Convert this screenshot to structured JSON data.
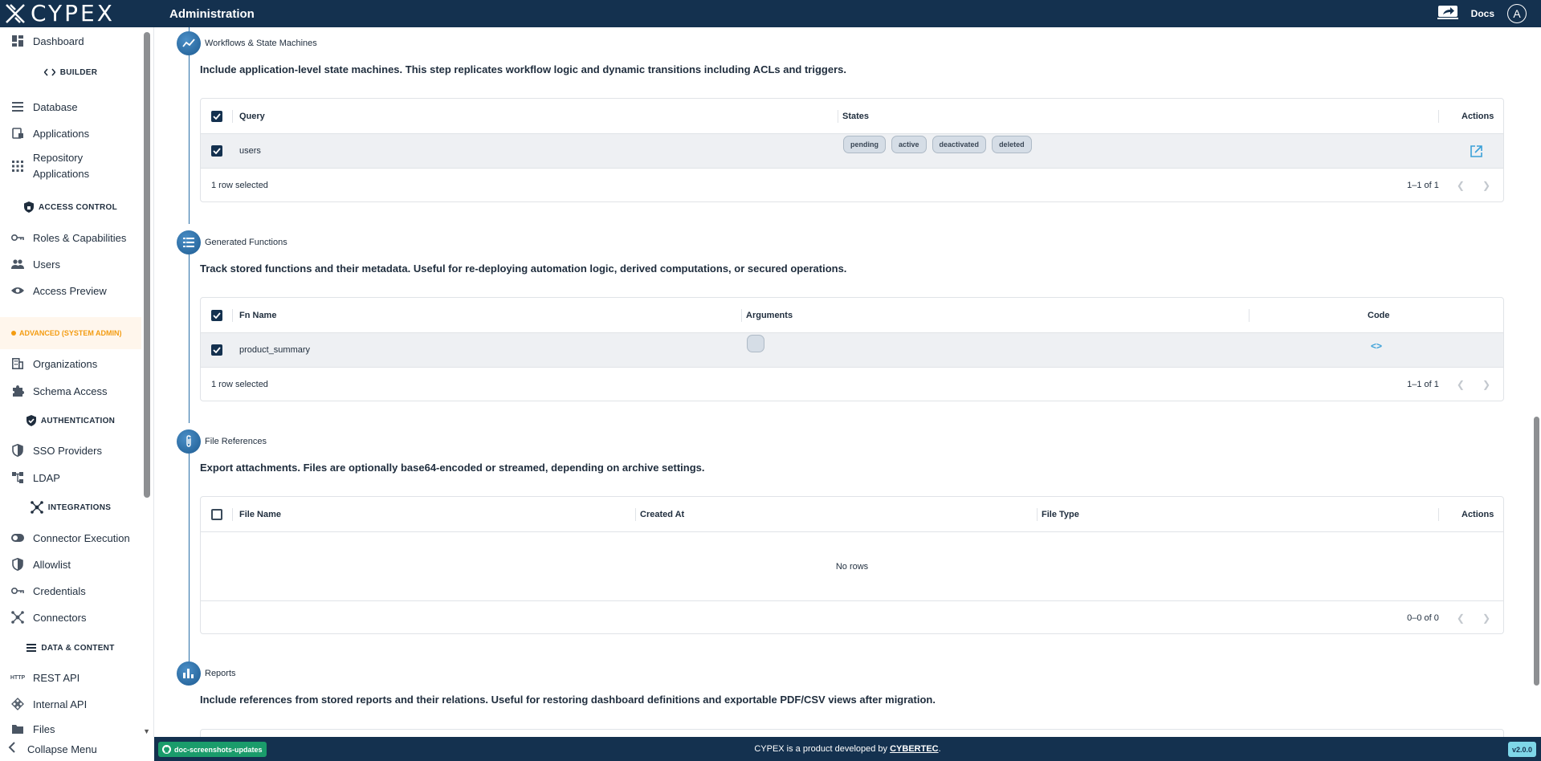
{
  "app": {
    "logo": "CYPEX",
    "title": "Administration",
    "docs": "Docs",
    "avatar": "A"
  },
  "sidebar": {
    "dashboard": "Dashboard",
    "builder": "BUILDER",
    "database": "Database",
    "applications": "Applications",
    "repository_1": "Repository",
    "repository_2": "Applications",
    "access_control": "ACCESS CONTROL",
    "roles": "Roles & Capabilities",
    "users": "Users",
    "access_preview": "Access Preview",
    "advanced": "ADVANCED (SYSTEM ADMIN)",
    "organizations": "Organizations",
    "schema_access": "Schema Access",
    "authentication": "AUTHENTICATION",
    "sso": "SSO Providers",
    "ldap": "LDAP",
    "integrations": "INTEGRATIONS",
    "connector_execution": "Connector Execution",
    "allowlist": "Allowlist",
    "credentials": "Credentials",
    "connectors": "Connectors",
    "data_content": "DATA & CONTENT",
    "rest_api": "REST API",
    "rest_icon": "HTTP",
    "internal_api": "Internal API",
    "files": "Files",
    "collapse": "Collapse Menu"
  },
  "workflows": {
    "title": "Workflows & State Machines",
    "description": "Include application-level state machines. This step replicates workflow logic and dynamic transitions including ACLs and triggers.",
    "columns": {
      "query": "Query",
      "states": "States",
      "actions": "Actions"
    },
    "row": {
      "query": "users",
      "states": [
        "pending",
        "active",
        "deactivated",
        "deleted"
      ]
    },
    "selected": "1 row selected",
    "pagination": "1–1 of 1"
  },
  "functions": {
    "title": "Generated Functions",
    "description": "Track stored functions and their metadata. Useful for re-deploying automation logic, derived computations, or secured operations.",
    "columns": {
      "fn_name": "Fn Name",
      "arguments": "Arguments",
      "code": "Code"
    },
    "row": {
      "fn_name": "product_summary",
      "code_icon": "<>"
    },
    "selected": "1 row selected",
    "pagination": "1–1 of 1"
  },
  "files": {
    "title": "File References",
    "description": "Export attachments. Files are optionally base64-encoded or streamed, depending on archive settings.",
    "columns": {
      "file_name": "File Name",
      "created_at": "Created At",
      "file_type": "File Type",
      "actions": "Actions"
    },
    "empty": "No rows",
    "pagination": "0–0 of 0"
  },
  "reports": {
    "title": "Reports",
    "description": "Include references from stored reports and their relations. Useful for restoring dashboard definitions and exportable PDF/CSV views after migration."
  },
  "footer": {
    "branch": "doc-screenshots-updates",
    "text_prefix": "CYPEX is a product developed by ",
    "link": "CYBERTEC",
    "text_suffix": ".",
    "version": "v2.0.0"
  },
  "colors": {
    "navbar": "#14314f",
    "accent": "#2a6fa8",
    "advanced": "#f39c12",
    "branch": "#1a9c6b"
  }
}
